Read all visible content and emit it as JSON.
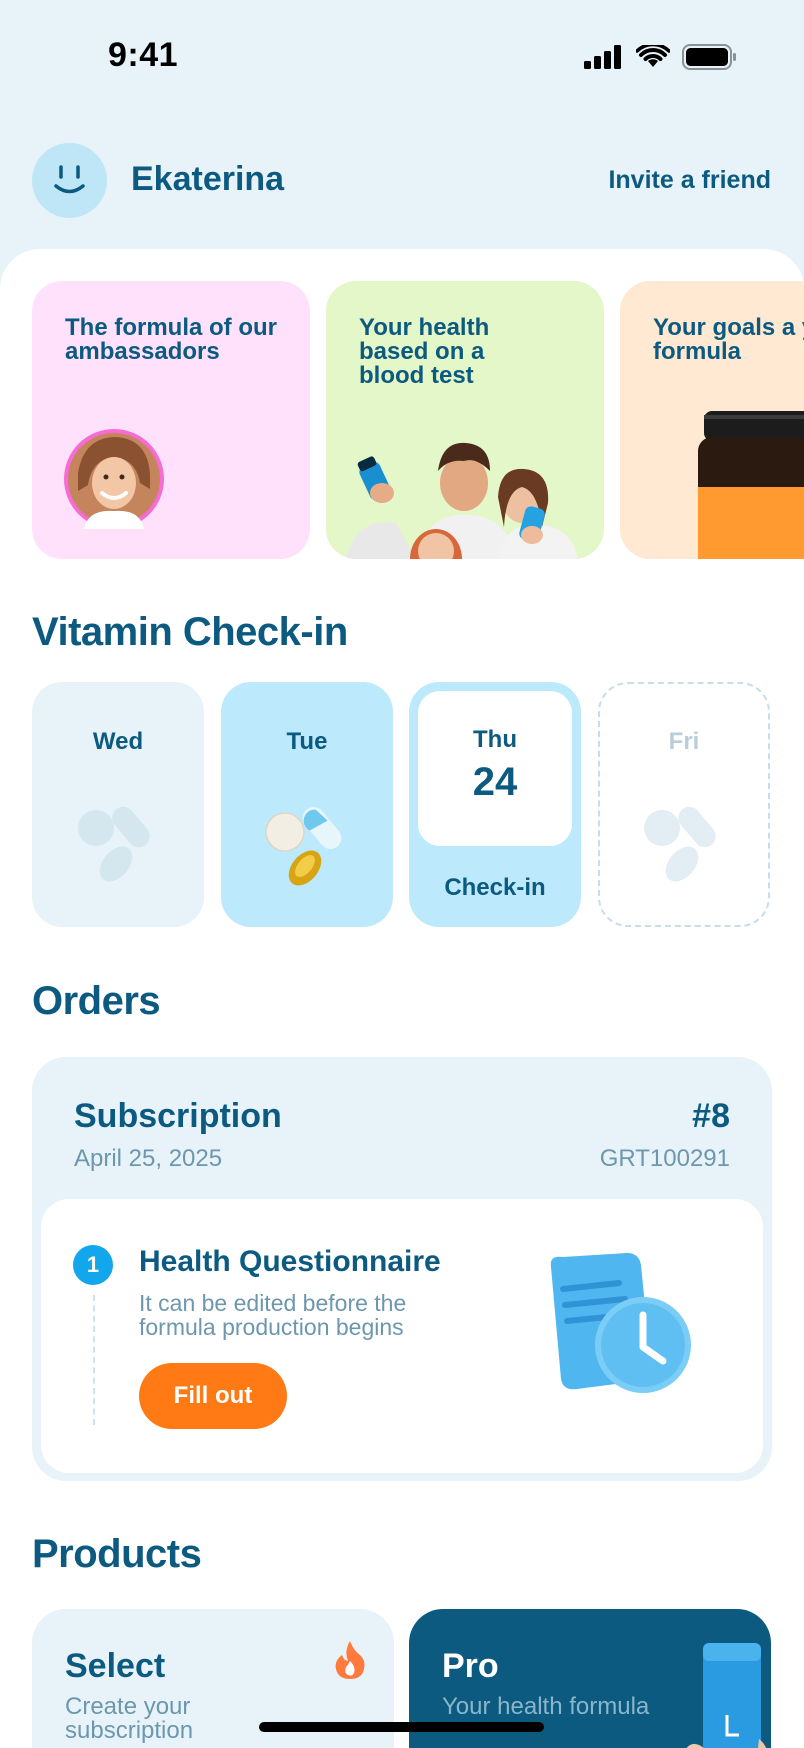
{
  "status": {
    "time": "9:41"
  },
  "header": {
    "username": "Ekaterina",
    "invite_label": "Invite a friend"
  },
  "promos": [
    {
      "text": "The formula of our ambassadors",
      "bg": "#ffe1fb"
    },
    {
      "text": "Your health based on a blood test",
      "bg": "#e3f7c8"
    },
    {
      "text": "Your goals a your formula",
      "bg": "#ffe9d2"
    }
  ],
  "checkin": {
    "title": "Vitamin Check-in",
    "days": [
      {
        "label": "Wed"
      },
      {
        "label": "Tue"
      },
      {
        "label": "Thu",
        "date": "24",
        "action": "Check-in"
      },
      {
        "label": "Fri"
      }
    ]
  },
  "orders": {
    "title": "Orders",
    "order": {
      "type": "Subscription",
      "date": "April 25, 2025",
      "number": "#8",
      "code": "GRT100291",
      "step": {
        "index": "1",
        "title": "Health Questionnaire",
        "description": "It can be edited before the formula production begins",
        "button": "Fill out"
      }
    }
  },
  "products": {
    "title": "Products",
    "items": [
      {
        "title": "Select",
        "subtitle": "Create your subscription"
      },
      {
        "title": "Pro",
        "subtitle": "Your health formula"
      }
    ]
  },
  "colors": {
    "accent": "#ff7a14",
    "primary": "#0c5a80",
    "light_blue": "#bde9fc",
    "step_blue": "#12a7ec"
  }
}
